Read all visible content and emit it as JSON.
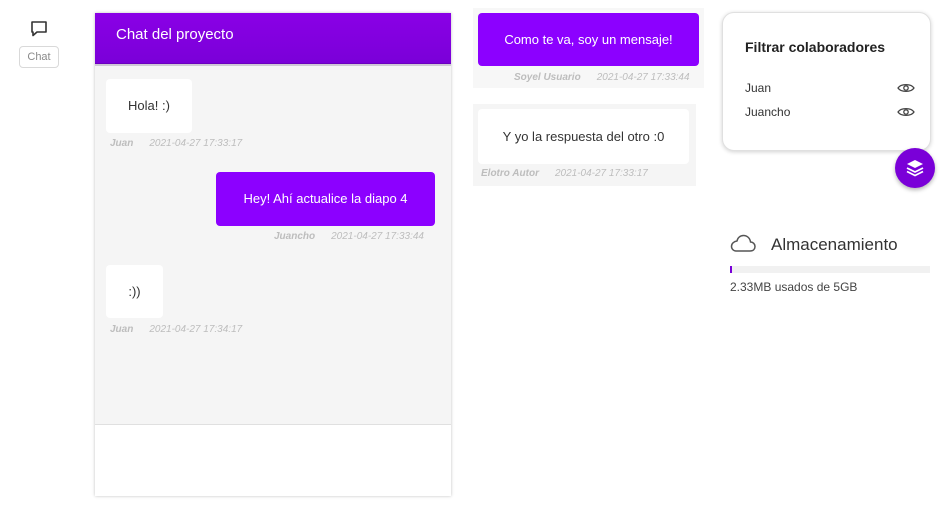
{
  "sidebar": {
    "chat_label": "Chat"
  },
  "chat": {
    "title": "Chat del proyecto",
    "messages": [
      {
        "text": "Hola! :)",
        "author": "Juan",
        "time": "2021-04-27 17:33:17",
        "own": false
      },
      {
        "text": "Hey! Ahí actualice la diapo 4",
        "author": "Juancho",
        "time": "2021-04-27 17:33:44",
        "own": true
      },
      {
        "text": ":))",
        "author": "Juan",
        "time": "2021-04-27 17:34:17",
        "own": false
      }
    ]
  },
  "samples": {
    "outgoing": {
      "text": "Como te va, soy un mensaje!",
      "author": "Soyel Usuario",
      "time": "2021-04-27 17:33:44"
    },
    "incoming": {
      "text": "Y yo la respuesta del otro :0",
      "author": "Elotro Autor",
      "time": "2021-04-27 17:33:17"
    }
  },
  "filter": {
    "title": "Filtrar colaboradores",
    "collaborators": [
      {
        "name": "Juan",
        "icon": "eye-icon"
      },
      {
        "name": "Juancho",
        "icon": "eye-icon"
      }
    ]
  },
  "storage": {
    "title": "Almacenamiento",
    "usage_text": "2.33MB usados de 5GB",
    "used_fraction": 0.0005
  },
  "colors": {
    "accent": "#8c00ff",
    "accent_dark": "#7a00d8"
  }
}
